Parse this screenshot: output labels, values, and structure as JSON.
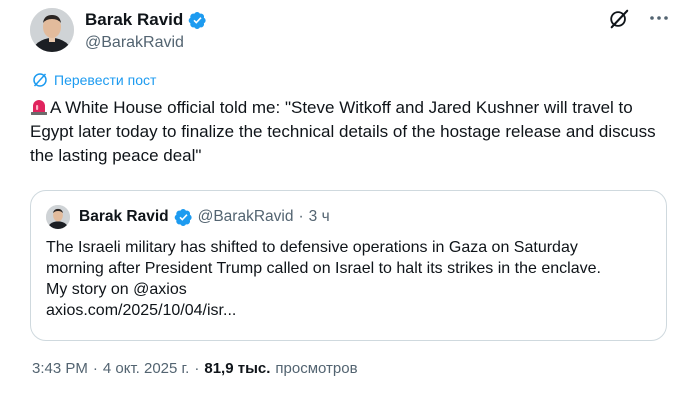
{
  "author": {
    "name": "Barak Ravid",
    "handle": "@BarakRavid"
  },
  "translate_label": "Перевести пост",
  "tweet": {
    "text": "A White House official told me: \"Steve Witkoff and Jared Kushner will travel to Egypt later today to finalize the technical details of the hostage release and discuss the lasting peace deal\""
  },
  "quote": {
    "name": "Barak Ravid",
    "handle": "@BarakRavid",
    "separator": "·",
    "time": "3 ч",
    "lines": [
      "The Israeli military has shifted to defensive operations in Gaza on Saturday",
      "morning after President Trump called on Israel to halt its strikes in the enclave.",
      "My story on @axios",
      "axios.com/2025/10/04/isr..."
    ]
  },
  "meta": {
    "time": "3:43 PM",
    "separator1": "·",
    "date": "4 окт. 2025 г.",
    "separator2": "·",
    "views_count": "81,9 тыс.",
    "views_label": "просмотров"
  },
  "colors": {
    "accent": "#1d9bf0",
    "text": "#0f1419",
    "secondary": "#536471",
    "border": "#cfd9de",
    "siren": "#e0245e"
  },
  "icons": [
    "verified-badge-icon",
    "grok-icon",
    "more-icon",
    "translate-icon",
    "siren-emoji-icon"
  ]
}
